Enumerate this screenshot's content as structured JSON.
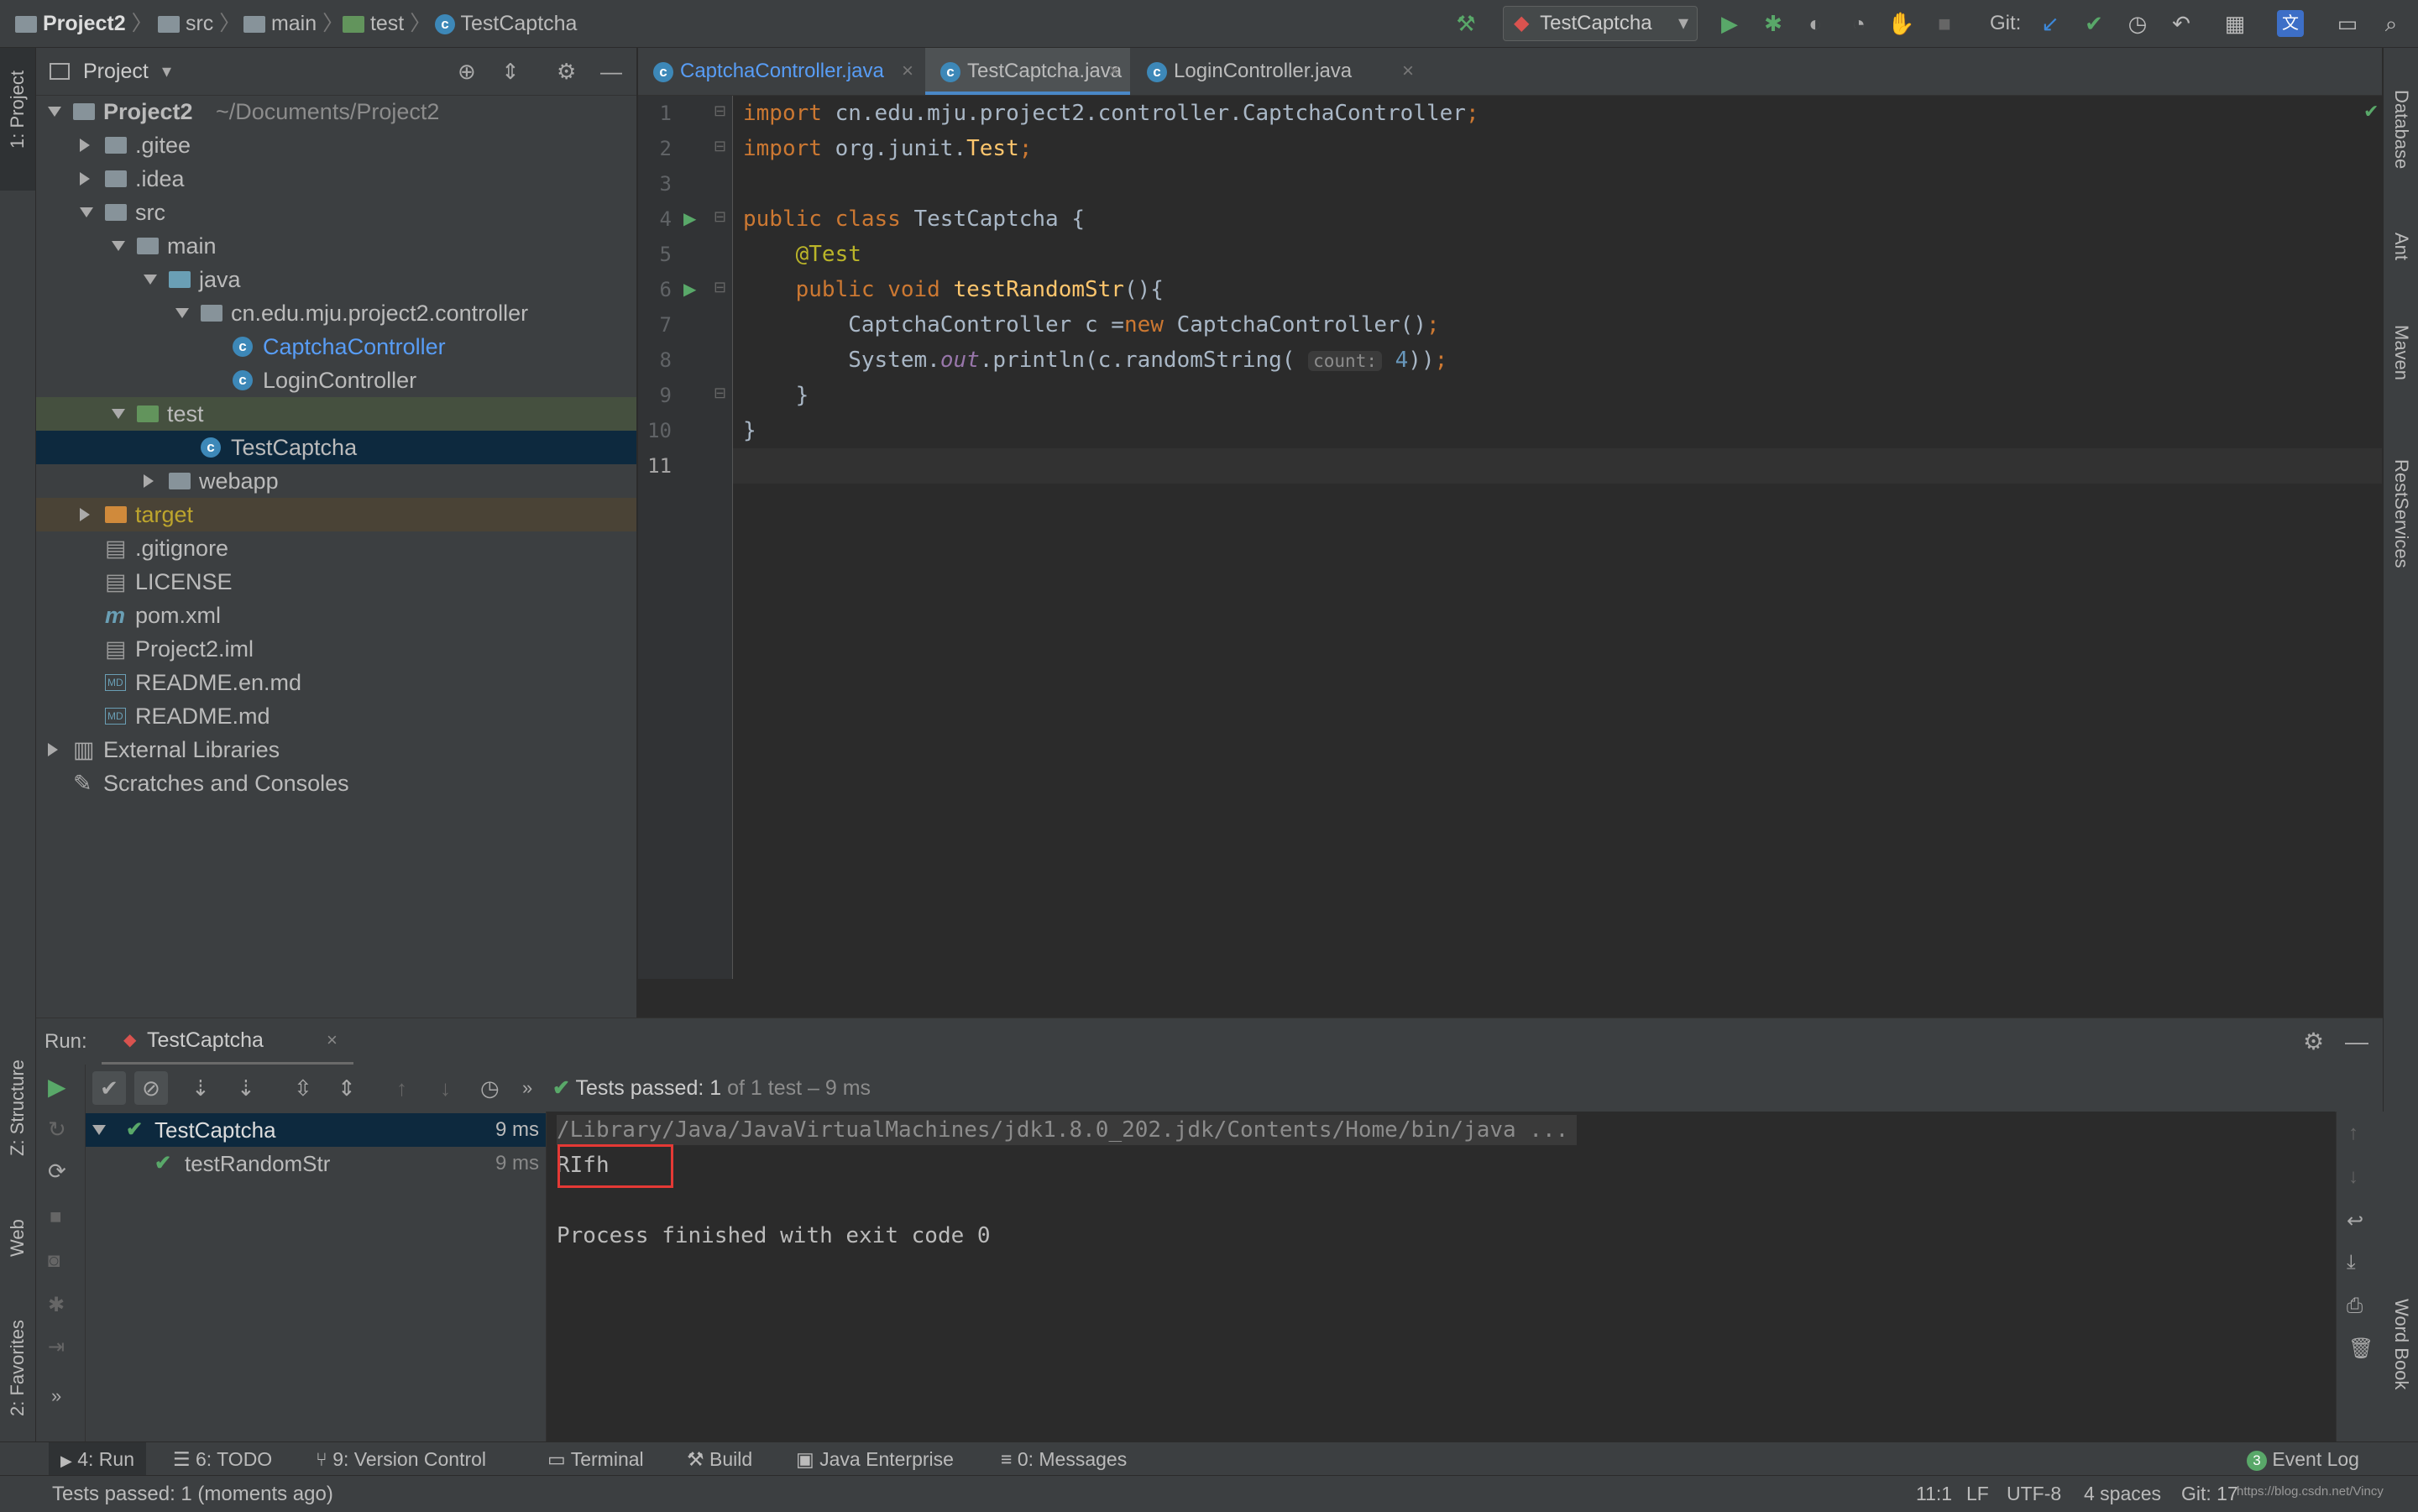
{
  "breadcrumb": [
    "Project2",
    "src",
    "main",
    "test",
    "TestCaptcha"
  ],
  "run_config": "TestCaptcha",
  "git_label": "Git:",
  "left_strip": {
    "project": "1: Project",
    "structure": "Z: Structure",
    "web": "Web",
    "favorites": "2: Favorites"
  },
  "right_strip": [
    "Database",
    "Ant",
    "Maven",
    "RestServices",
    "Word Book"
  ],
  "project_panel": {
    "title": "Project",
    "tree": [
      {
        "label": "Project2",
        "extra": "~/Documents/Project2",
        "depth": 0,
        "exp": "down",
        "icon": "folder"
      },
      {
        "label": ".gitee",
        "depth": 1,
        "exp": "right",
        "icon": "folder"
      },
      {
        "label": ".idea",
        "depth": 1,
        "exp": "right",
        "icon": "folder"
      },
      {
        "label": "src",
        "depth": 1,
        "exp": "down",
        "icon": "folder"
      },
      {
        "label": "main",
        "depth": 2,
        "exp": "down",
        "icon": "folder"
      },
      {
        "label": "java",
        "depth": 3,
        "exp": "down",
        "icon": "folder-blue"
      },
      {
        "label": "cn.edu.mju.project2.controller",
        "depth": 4,
        "exp": "down",
        "icon": "package"
      },
      {
        "label": "CaptchaController",
        "depth": 5,
        "exp": "",
        "icon": "class",
        "color": "#589df6"
      },
      {
        "label": "LoginController",
        "depth": 5,
        "exp": "",
        "icon": "class"
      },
      {
        "label": "test",
        "depth": 2,
        "exp": "down",
        "icon": "folder-green"
      },
      {
        "label": "TestCaptcha",
        "depth": 4,
        "exp": "",
        "icon": "class"
      },
      {
        "label": "webapp",
        "depth": 3,
        "exp": "right",
        "icon": "folder"
      },
      {
        "label": "target",
        "depth": 1,
        "exp": "right",
        "icon": "folder-orange",
        "color": "#bda52d"
      },
      {
        "label": ".gitignore",
        "depth": 1,
        "exp": "",
        "icon": "file"
      },
      {
        "label": "LICENSE",
        "depth": 1,
        "exp": "",
        "icon": "file"
      },
      {
        "label": "pom.xml",
        "depth": 1,
        "exp": "",
        "icon": "maven"
      },
      {
        "label": "Project2.iml",
        "depth": 1,
        "exp": "",
        "icon": "file"
      },
      {
        "label": "README.en.md",
        "depth": 1,
        "exp": "",
        "icon": "md"
      },
      {
        "label": "README.md",
        "depth": 1,
        "exp": "",
        "icon": "md"
      },
      {
        "label": "External Libraries",
        "depth": 0,
        "exp": "right",
        "icon": "libs"
      },
      {
        "label": "Scratches and Consoles",
        "depth": 0,
        "exp": "",
        "icon": "scratch"
      }
    ]
  },
  "editor_tabs": [
    {
      "label": "CaptchaController.java",
      "active": false,
      "color": "#589df6"
    },
    {
      "label": "TestCaptcha.java",
      "active": true,
      "color": "#bbbbbb"
    },
    {
      "label": "LoginController.java",
      "active": false,
      "color": "#bbbbbb"
    }
  ],
  "line_numbers": [
    "1",
    "2",
    "3",
    "4",
    "5",
    "6",
    "7",
    "8",
    "9",
    "10",
    "11"
  ],
  "inlay_hint": "count:",
  "run_panel": {
    "label": "Run:",
    "tab": "TestCaptcha",
    "status_prefix": "Tests passed:",
    "status_count": "1",
    "status_suffix": "of 1 test – 9 ms",
    "tree": [
      {
        "label": "TestCaptcha",
        "time": "9 ms"
      },
      {
        "label": "testRandomStr",
        "time": "9 ms"
      }
    ],
    "console": {
      "cmd": "/Library/Java/JavaVirtualMachines/jdk1.8.0_202.jdk/Contents/Home/bin/java ...",
      "output": "RIfh",
      "exit": "Process finished with exit code 0"
    }
  },
  "bottom_tabs": [
    {
      "label": "4: Run",
      "icon": "play-icon"
    },
    {
      "label": "6: TODO",
      "icon": "list-icon"
    },
    {
      "label": "9: Version Control",
      "icon": "branch-icon"
    },
    {
      "label": "Terminal",
      "icon": "terminal-icon"
    },
    {
      "label": "Build",
      "icon": "hammer-icon"
    },
    {
      "label": "Java Enterprise",
      "icon": "enterprise-icon"
    },
    {
      "label": "0: Messages",
      "icon": "messages-icon"
    }
  ],
  "event_log": {
    "label": "Event Log",
    "count": "3"
  },
  "status_bar": {
    "message": "Tests passed: 1 (moments ago)",
    "position": "11:1",
    "line_sep": "LF",
    "encoding": "UTF-8",
    "indent": "4 spaces",
    "git": "Git: 17",
    "watermark": "https://blog.csdn.net/Vincy"
  },
  "colors": {
    "accent": "#4a88c7",
    "pass": "#59a869",
    "highlight_box": "#e53935"
  }
}
